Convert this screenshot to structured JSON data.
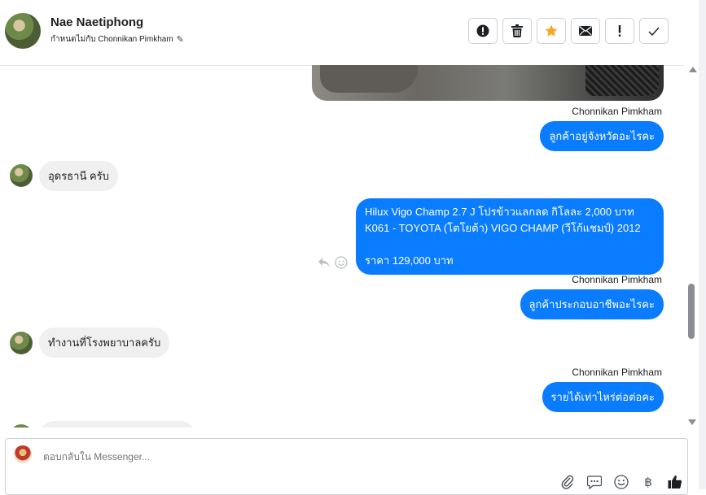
{
  "header": {
    "name": "Nae Naetiphong",
    "subtitle": "กำหนดไม่กับ Chonnikan Pimkham",
    "actions": [
      "report",
      "delete",
      "star",
      "mail",
      "important",
      "done"
    ]
  },
  "messages": {
    "sender1": "Chonnikan Pimkham",
    "out1": "ลูกค้าอยู่จังหวัดอะไรคะ",
    "in1": "อุดรธานี ครับ",
    "out2_line1": "Hilux Vigo Champ 2.7 J โปรข้าวแลกลด กิโลละ 2,000 บาท",
    "out2_line2": "K061 - TOYOTA (โตโยต้า) VIGO CHAMP (วีโก้แชมป์) 2012",
    "out2_line3": "",
    "out2_line4": "ราคา 129,000 บาท",
    "sender2": "Chonnikan Pimkham",
    "out3": "ลูกค้าประกอบอาชีพอะไรคะ",
    "in2": "ทำงานที่โรงพยาบาลครับ",
    "sender3": "Chonnikan Pimkham",
    "out4": "รายได้เท่าไหร่ต่อต่อคะ"
  },
  "composer": {
    "placeholder": "ตอบกลับใน Messenger...",
    "tools": [
      "attach-icon",
      "message-icon",
      "emoji-icon",
      "baht-icon",
      "like-icon"
    ],
    "baht_symbol": "฿"
  },
  "colors": {
    "outgoing": "#0a7cff",
    "incoming": "#f0f0f0",
    "star": "#f5a623"
  }
}
